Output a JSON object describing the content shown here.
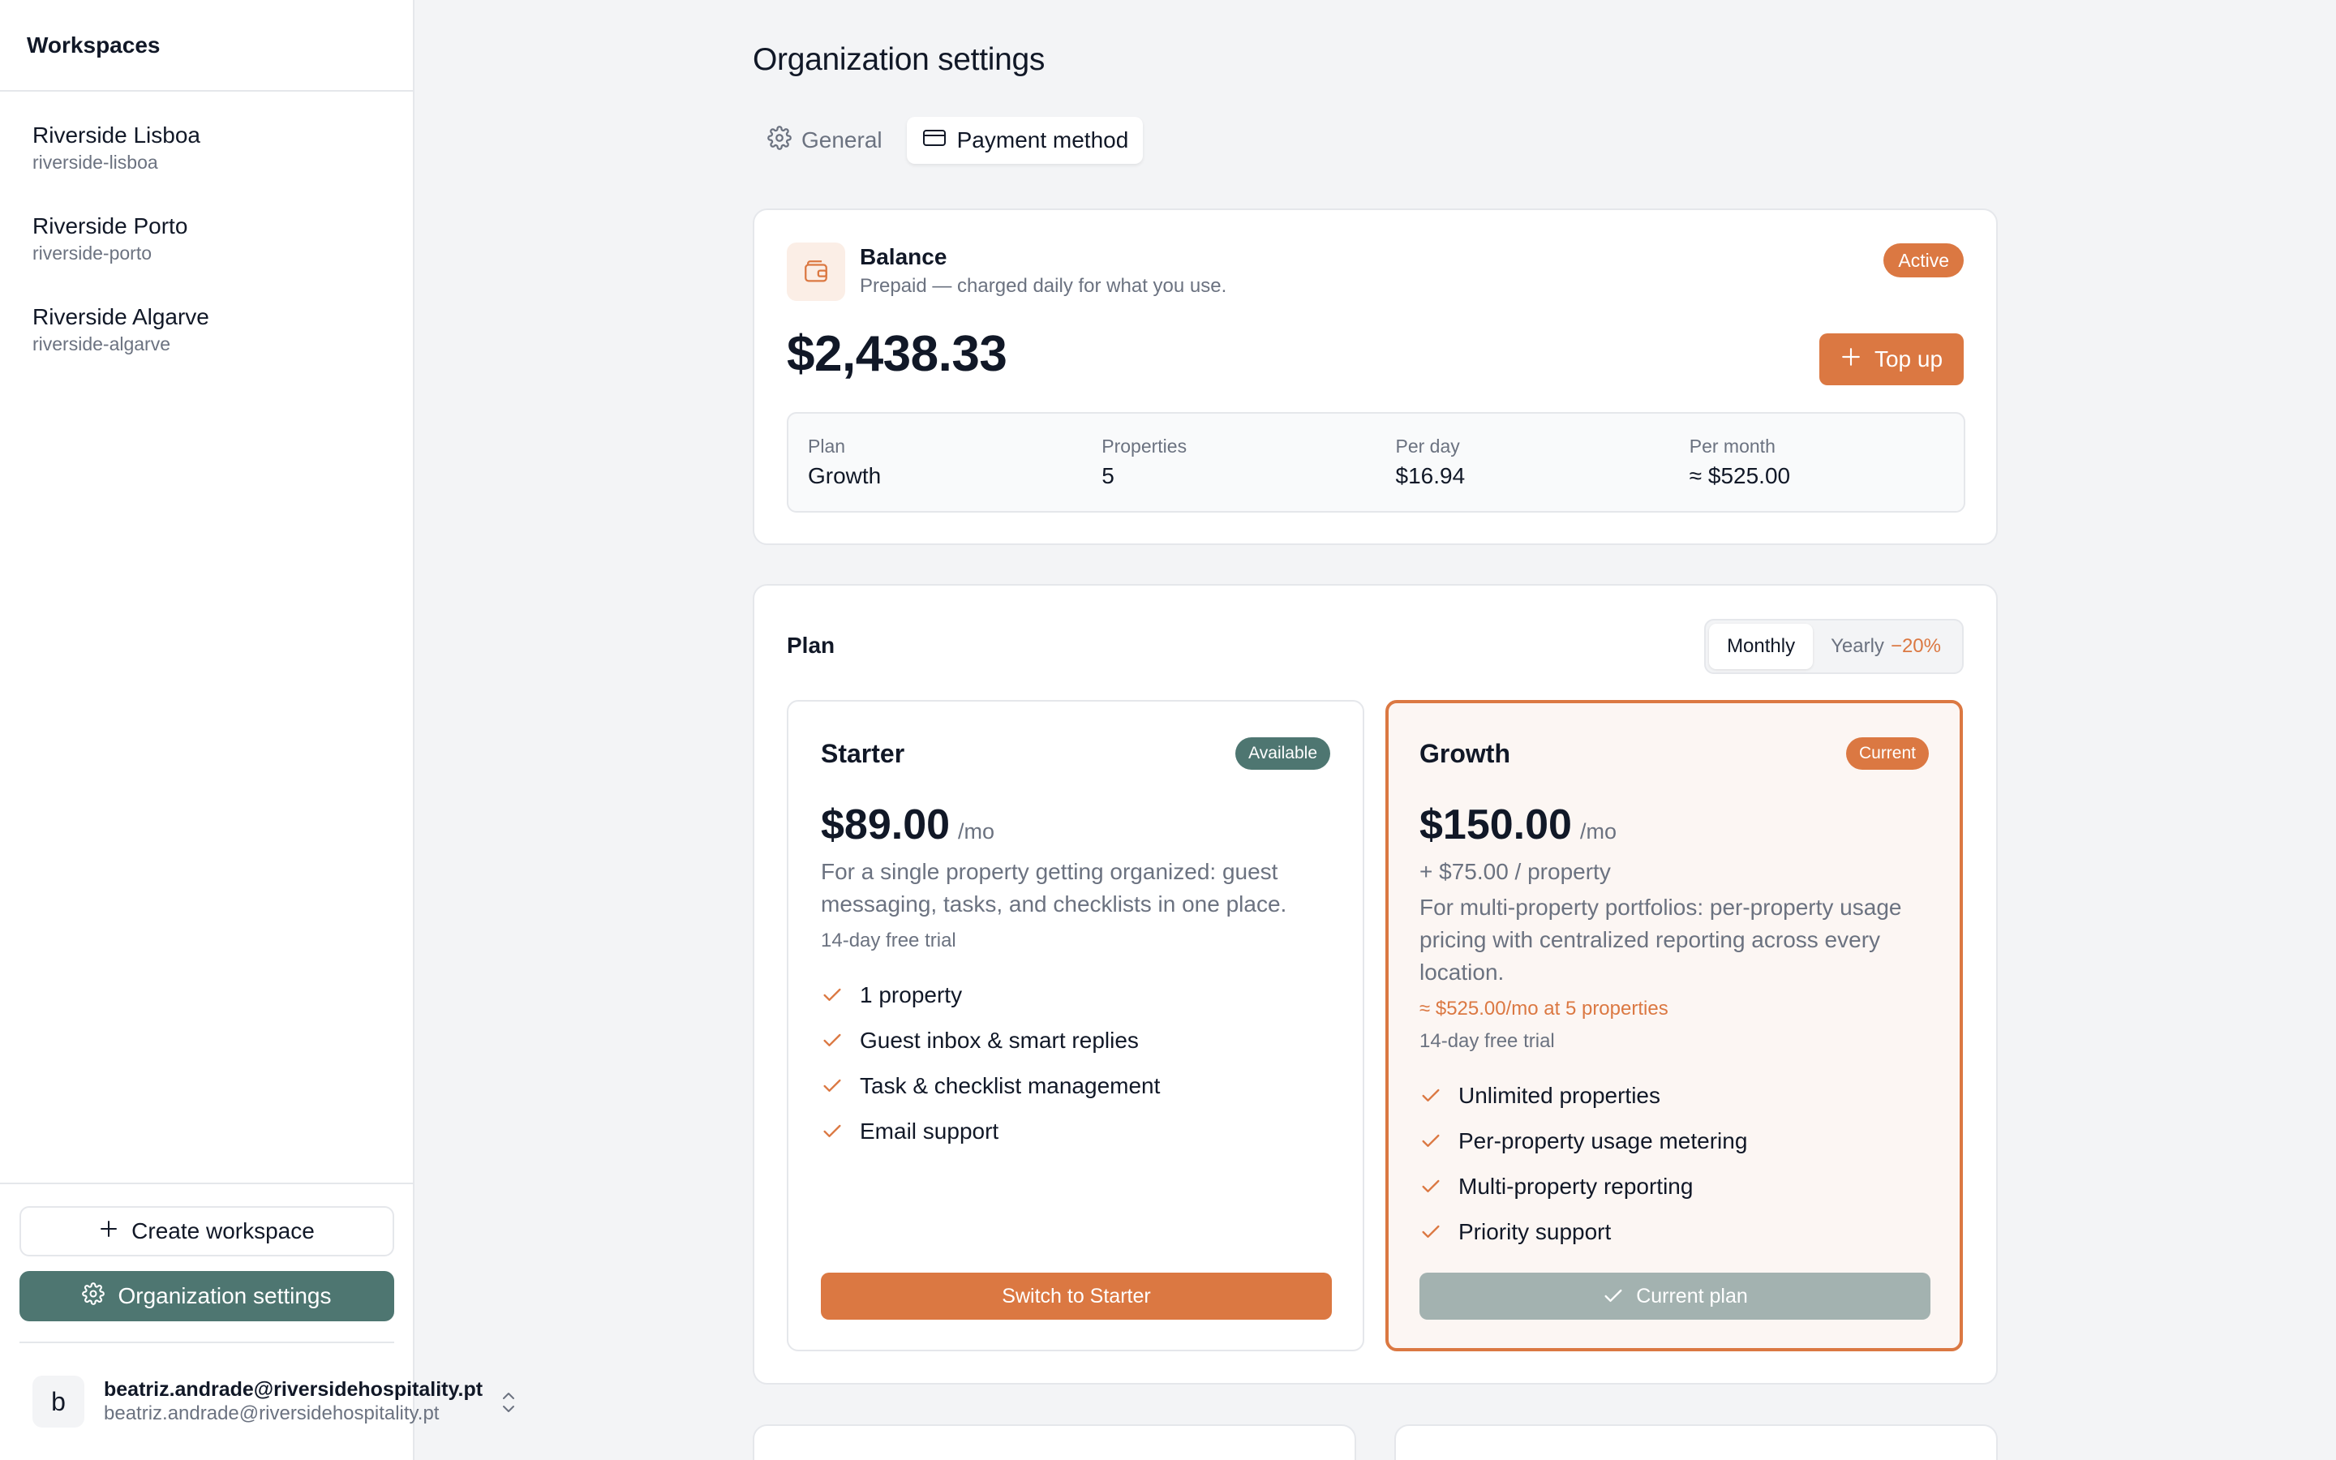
{
  "sidebar": {
    "header": "Workspaces",
    "workspaces": [
      {
        "name": "Riverside Lisboa",
        "slug": "riverside-lisboa"
      },
      {
        "name": "Riverside Porto",
        "slug": "riverside-porto"
      },
      {
        "name": "Riverside Algarve",
        "slug": "riverside-algarve"
      }
    ],
    "create_label": "Create workspace",
    "org_settings_label": "Organization settings",
    "user": {
      "initial": "b",
      "name": "beatriz.andrade@riversidehospitality.pt",
      "email": "beatriz.andrade@riversidehospitality.pt"
    }
  },
  "page": {
    "title": "Organization settings",
    "tabs": [
      {
        "label": "General",
        "icon": "gear-icon",
        "active": false
      },
      {
        "label": "Payment method",
        "icon": "credit-card-icon",
        "active": true
      }
    ]
  },
  "balance": {
    "title": "Balance",
    "subtitle": "Prepaid — charged daily for what you use.",
    "status": "Active",
    "amount": "$2,438.33",
    "topup_label": "Top up",
    "stats": [
      {
        "label": "Plan",
        "value": "Growth"
      },
      {
        "label": "Properties",
        "value": "5"
      },
      {
        "label": "Per day",
        "value": "$16.94"
      },
      {
        "label": "Per month",
        "value": "≈ $525.00"
      }
    ]
  },
  "plans": {
    "title": "Plan",
    "billing": {
      "monthly": "Monthly",
      "yearly": "Yearly",
      "yearly_discount": "−20%",
      "selected": "Monthly"
    },
    "starter": {
      "name": "Starter",
      "badge": "Available",
      "price": "$89.00",
      "unit": "/mo",
      "description": "For a single property getting organized: guest messaging, tasks, and checklists in one place.",
      "trial": "14-day free trial",
      "features": [
        "1 property",
        "Guest inbox & smart replies",
        "Task & checklist management",
        "Email support"
      ],
      "button": "Switch to Starter"
    },
    "growth": {
      "name": "Growth",
      "badge": "Current",
      "price": "$150.00",
      "unit": "/mo",
      "addon": "+ $75.00 / property",
      "description": "For multi-property portfolios: per-property usage pricing with centralized reporting across every location.",
      "estimate": "≈ $525.00/mo at 5 properties",
      "trial": "14-day free trial",
      "features": [
        "Unlimited properties",
        "Per-property usage metering",
        "Multi-property reporting",
        "Priority support"
      ],
      "button": "Current plan"
    }
  },
  "colors": {
    "accent": "#db7842",
    "sidebar_button": "#4e7671",
    "available_badge": "#4e7671",
    "disabled_button": "#a3b2b0"
  }
}
